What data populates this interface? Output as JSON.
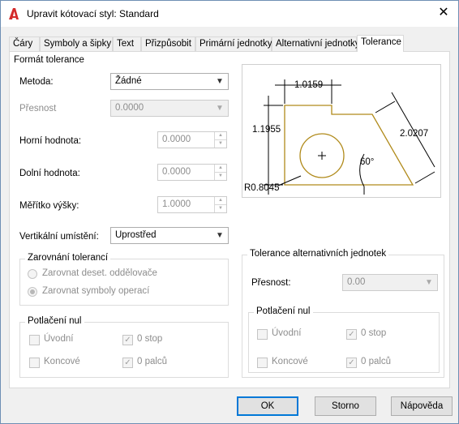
{
  "window": {
    "title": "Upravit kótovací styl: Standard"
  },
  "tabs": [
    {
      "label": "Čáry"
    },
    {
      "label": "Symboly a šipky"
    },
    {
      "label": "Text"
    },
    {
      "label": "Přizpůsobit"
    },
    {
      "label": "Primární jednotky"
    },
    {
      "label": "Alternativní jednotky"
    },
    {
      "label": "Tolerance"
    }
  ],
  "format": {
    "legend": "Formát tolerance",
    "method_label": "Metoda:",
    "method_value": "Žádné",
    "precision_label": "Přesnost",
    "precision_value": "0.0000",
    "upper_label": "Horní hodnota:",
    "upper_value": "0.0000",
    "lower_label": "Dolní hodnota:",
    "lower_value": "0.0000",
    "height_label": "Měřítko výšky:",
    "height_value": "1.0000",
    "vpos_label": "Vertikální umístění:",
    "vpos_value": "Uprostřed"
  },
  "alignment": {
    "legend": "Zarovnání tolerancí",
    "opt1": "Zarovnat deset. oddělovače",
    "opt2": "Zarovnat symboly operací"
  },
  "zero_left": {
    "legend": "Potlačení nul",
    "leading": "Úvodní",
    "trailing": "Koncové",
    "feet": "0 stop",
    "inches": "0 palců"
  },
  "alt": {
    "legend": "Tolerance alternativních jednotek",
    "precision_label": "Přesnost:",
    "precision_value": "0.00"
  },
  "zero_right": {
    "legend": "Potlačení nul",
    "leading": "Úvodní",
    "trailing": "Koncové",
    "feet": "0 stop",
    "inches": "0 palců"
  },
  "preview": {
    "dim_top": "1.0159",
    "dim_left": "1.1955",
    "dim_right": "2.0207",
    "dim_angle": "60°",
    "dim_radius": "R0.8045"
  },
  "buttons": {
    "ok": "OK",
    "cancel": "Storno",
    "help": "Nápověda"
  },
  "colors": {
    "shape": "#b08a1a",
    "accent": "#0078d7"
  }
}
